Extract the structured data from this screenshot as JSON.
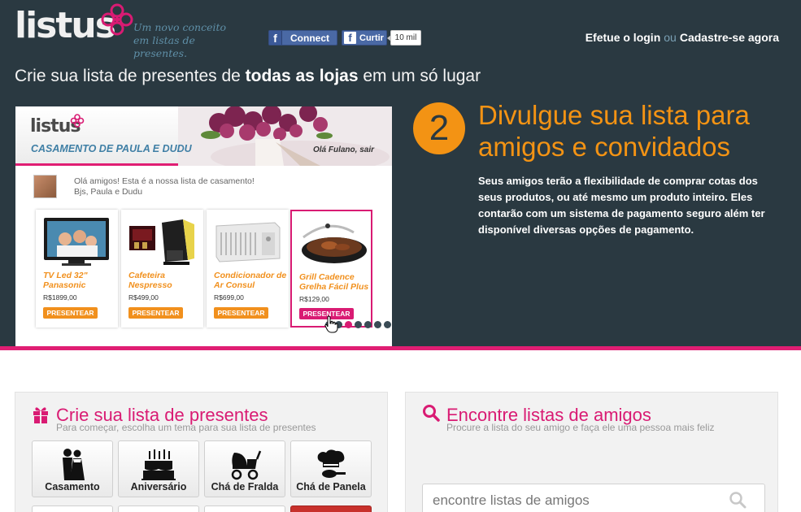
{
  "brand": {
    "logo": "listus",
    "tagline_line1": "Um novo conceito",
    "tagline_line2": "em listas de presentes."
  },
  "facebook": {
    "connect_label": "Connect",
    "like_label": "Curtir",
    "like_count": "10 mil"
  },
  "auth": {
    "login": "Efetue o login",
    "or": "ou",
    "signup": "Cadastre-se agora"
  },
  "headline": {
    "part1": "Crie sua lista de presentes de ",
    "bold": "todas as lojas",
    "part2": " em um só lugar"
  },
  "preview": {
    "logo": "listus",
    "list_title": "CASAMENTO DE PAULA E DUDU",
    "greeting": "Olá Fulano, sair",
    "message_line1": "Olá amigos! Esta é a nossa lista de casamento!",
    "message_line2": "Bjs, Paula e Dudu",
    "products": [
      {
        "name": "TV Led 32\" Panasonic",
        "price": "R$1899,00",
        "button": "PRESENTEAR"
      },
      {
        "name": "Cafeteira Nespresso",
        "price": "R$499,00",
        "button": "PRESENTEAR"
      },
      {
        "name": "Condicionador de Ar Consul",
        "price": "R$699,00",
        "button": "PRESENTEAR"
      },
      {
        "name": "Grill Cadence Grelha Fácil Plus",
        "price": "R$129,00",
        "button": "PRESENTEAR"
      }
    ],
    "slide_count": 7,
    "active_slide": 3
  },
  "step": {
    "number": "2",
    "title": "Divulgue sua lista para amigos e convidados",
    "description": "Seus amigos terão a flexibilidade de comprar cotas dos seus produtos, ou até mesmo um produto inteiro. Eles contarão com um sistema de pagamento seguro além ter disponível diversas opções de pagamento."
  },
  "create_panel": {
    "title": "Crie sua lista de presentes",
    "subtitle": "Para começar, escolha um tema para sua lista de presentes",
    "categories": [
      {
        "label": "Casamento",
        "icon": "wedding-couple-icon"
      },
      {
        "label": "Aniversário",
        "icon": "birthday-cake-icon"
      },
      {
        "label": "Chá de Fralda",
        "icon": "baby-stroller-icon"
      },
      {
        "label": "Chá de Panela",
        "icon": "chef-hat-icon"
      }
    ]
  },
  "search_panel": {
    "title": "Encontre listas de amigos",
    "subtitle": "Procure a lista do seu amigo e faça ele uma pessoa mais feliz",
    "placeholder": "encontre listas de amigos"
  },
  "colors": {
    "dark_bg": "#2a3941",
    "pink": "#e01e73",
    "orange": "#f39314",
    "blue_tag": "#5f8fa7"
  }
}
